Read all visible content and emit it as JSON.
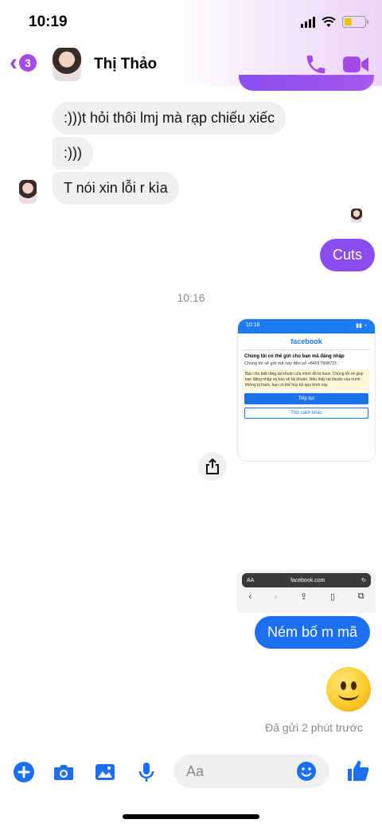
{
  "status_bar": {
    "time": "10:19"
  },
  "header": {
    "back_count": "3",
    "contact_name": "Thị Thảo",
    "icons": [
      "phone-icon",
      "video-camera-icon"
    ]
  },
  "messages": {
    "incoming": [
      ":)))t hỏi thôi lmj mà rạp chiếu xiếc",
      ":)))",
      "T nói xin lỗi r kìa"
    ],
    "outgoing_cuts": "Cuts",
    "timestamp": "10:16",
    "outgoing_final": "Ném bố m mã",
    "read_receipt": "Đã gửi 2 phút trước"
  },
  "shared_screenshot": {
    "time": "10:16",
    "brand": "facebook",
    "heading": "Chúng tôi có thể gửi cho bạn mã đăng nhập",
    "line": "Chúng tôi sẽ gửi mã này đến số +84917908721.",
    "warning": "Bạn cho biết rằng tài khoản của mình đã bị hack. Chúng tôi sẽ giúp bạn đăng nhập và bảo vệ tài khoản. Nếu thấy tài khoản của mình không bị hack, bạn có thể hủy bỏ quy trình này.",
    "primary_button": "Tiếp tục",
    "secondary_button": "Thử cách khác"
  },
  "browser_snippet": {
    "aa": "AA",
    "url": "facebook.com"
  },
  "composer": {
    "placeholder": "Aa",
    "icons": [
      "plus-icon",
      "camera-icon",
      "image-icon",
      "microphone-icon",
      "emoji-icon",
      "thumbs-up-icon"
    ]
  },
  "colors": {
    "accent": "#a44ae8",
    "outgoing_blue": "#1d6ff2",
    "outgoing_purple": "#8a4cf0",
    "incoming_bg": "#f0f0f0"
  }
}
